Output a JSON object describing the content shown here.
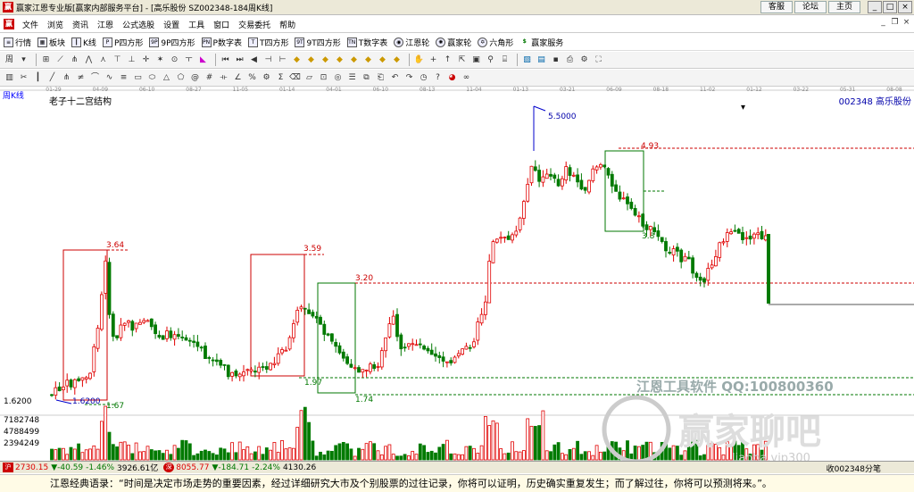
{
  "window": {
    "title": "赢家江恩专业版[赢家内部服务平台] - [高乐股份  SZ002348-184周K线]",
    "links": [
      "客服",
      "论坛",
      "主页"
    ],
    "app_icon": "赢"
  },
  "menu": [
    "文件",
    "浏览",
    "资讯",
    "江恩",
    "公式选股",
    "设置",
    "工具",
    "窗口",
    "交易委托",
    "帮助"
  ],
  "toolbar1": [
    {
      "icon": "list-icon",
      "label": "行情"
    },
    {
      "icon": "grid-icon",
      "label": "板块"
    },
    {
      "icon": "kline-icon",
      "label": "K线"
    },
    {
      "icon": "p-square-icon",
      "label": "P四方形"
    },
    {
      "icon": "9p-square-icon",
      "label": "9P四方形"
    },
    {
      "icon": "p-number-table-icon",
      "label": "P数字表"
    },
    {
      "icon": "t-square-icon",
      "label": "T四方形"
    },
    {
      "icon": "9t-square-icon",
      "label": "9T四方形"
    },
    {
      "icon": "t-number-table-icon",
      "label": "T数字表"
    },
    {
      "icon": "gann-wheel-icon",
      "label": "江恩轮"
    },
    {
      "icon": "winner-wheel-icon",
      "label": "赢家轮"
    },
    {
      "icon": "hexagon-icon",
      "label": "六角形"
    },
    {
      "icon": "dollar-icon",
      "label": "赢家服务"
    }
  ],
  "toolbar2_first": "周",
  "chart": {
    "period_label": "周K线",
    "indicator_name": "老子十二宫结构",
    "stock_code_name": "002348 高乐股份",
    "date_ticks": [
      "01-29",
      "04-09",
      "06-10",
      "08-27",
      "11-05",
      "01-14",
      "04-01",
      "06-10",
      "08-13",
      "11-04",
      "01-13",
      "03-21",
      "06-09",
      "08-18",
      "11-02",
      "01-12",
      "03-22",
      "05-31",
      "08-08"
    ],
    "y_labels": [
      "1.6200"
    ],
    "vol_labels": [
      "7182748",
      "4788499",
      "2394249"
    ],
    "annotations": [
      "5.5000",
      "4.93",
      "3.8",
      "3.64",
      "3.59",
      "3.20",
      "1.97",
      "1.74",
      "1.6200",
      "1.67"
    ],
    "colors": {
      "up": "#e00000",
      "down": "#007a00",
      "bg": "#ffffff"
    }
  },
  "status": {
    "sh_label": "沪",
    "sh": "2730.15",
    "sh_chg": "▼-40.59",
    "sh_pct": "-1.46%",
    "sh_amt": "3926.61亿",
    "sz_label": "深",
    "sz": "8055.77",
    "sz_chg": "▼-184.71",
    "sz_pct": "-2.24%",
    "sz_amt": "4130.26",
    "right_text": "收002348分笔"
  },
  "watermark": {
    "line1": "江恩工具软件  QQ:100800360",
    "line2": "赢家聊吧",
    "line3": "liaoba.vip300"
  },
  "quote": "江恩经典语录：“时间是决定市场走势的重要因素，经过详细研究大市及个别股票的过往记录，你将可以证明，历史确实重复发生；而了解过往，你将可以预测将来。”。"
}
